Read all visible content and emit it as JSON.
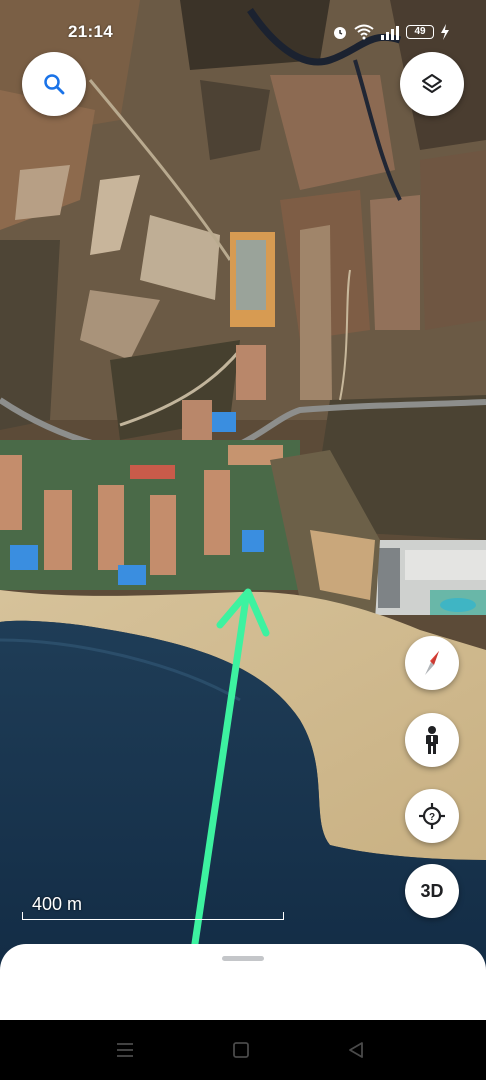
{
  "status_bar": {
    "time": "21:14",
    "battery_level": "49",
    "icons": [
      "alarm-icon",
      "wifi-icon",
      "signal-icon",
      "battery-icon",
      "charging-icon"
    ]
  },
  "map": {
    "type": "satellite",
    "scale_label": "400 m"
  },
  "controls": {
    "search_icon": "search-icon",
    "layers_icon": "layers-icon",
    "compass_icon": "compass-icon",
    "pegman_icon": "pegman-icon",
    "my_location_icon": "my-location-icon",
    "three_d_label": "3D"
  },
  "navigation": {
    "items": [
      "menu-icon",
      "home-icon",
      "back-icon"
    ]
  },
  "colors": {
    "annotation_arrow": "#3df2a0",
    "compass_red": "#e8453c",
    "button_icon": "#1a73e8"
  }
}
